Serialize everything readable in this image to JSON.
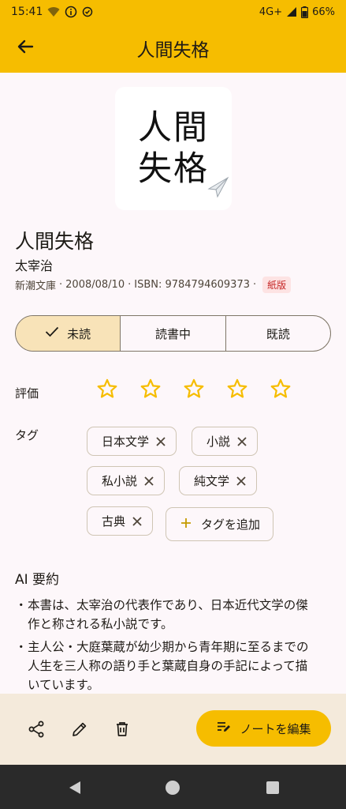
{
  "status_bar": {
    "time": "15:41",
    "network": "4G+",
    "battery": "66%",
    "icons": [
      "wifi-off-icon",
      "info-icon",
      "sync-check-icon",
      "signal-icon",
      "battery-icon"
    ]
  },
  "app_bar": {
    "title": "人間失格",
    "back_icon": "arrow-back-icon"
  },
  "cover": {
    "line1": "人間",
    "line2": "失格",
    "badge_icon": "paper-plane-icon"
  },
  "book": {
    "title": "人間失格",
    "author": "太宰治",
    "publisher": "新潮文庫",
    "date": "2008/08/10",
    "isbn": "ISBN: 9784794609373",
    "separator": "·",
    "format": "紙版"
  },
  "reading_status": {
    "options": [
      "未読",
      "読書中",
      "既読"
    ],
    "selected": "未読"
  },
  "rating": {
    "label": "評価",
    "value": 0,
    "max": 5
  },
  "tags": {
    "label": "タグ",
    "items": [
      "日本文学",
      "小説",
      "私小説",
      "純文学",
      "古典"
    ],
    "add_label": "タグを追加"
  },
  "ai_summary": {
    "title": "AI 要約",
    "bullets": [
      [
        "本書は、太宰治の代表作であり、日本近代文学の傑",
        "作と称される私小説です。"
      ],
      [
        "主人公・大庭葉蔵が幼少期から青年期に至るまでの",
        "人生を三人称の語り手と葉蔵自身の手記によって描",
        "いています。"
      ]
    ]
  },
  "bottom_bar": {
    "edit_note_label": "ノートを編集",
    "icons": [
      "share-icon",
      "edit-icon",
      "delete-icon",
      "note-edit-icon"
    ]
  },
  "colors": {
    "accent": "#f6bd00",
    "selected_segment": "#f8e3b8",
    "background": "#fdf7fa",
    "bottom_bar": "#f4eadb",
    "star": "#f6bd00",
    "badge_bg": "#fde3e3",
    "badge_text": "#c62828"
  }
}
